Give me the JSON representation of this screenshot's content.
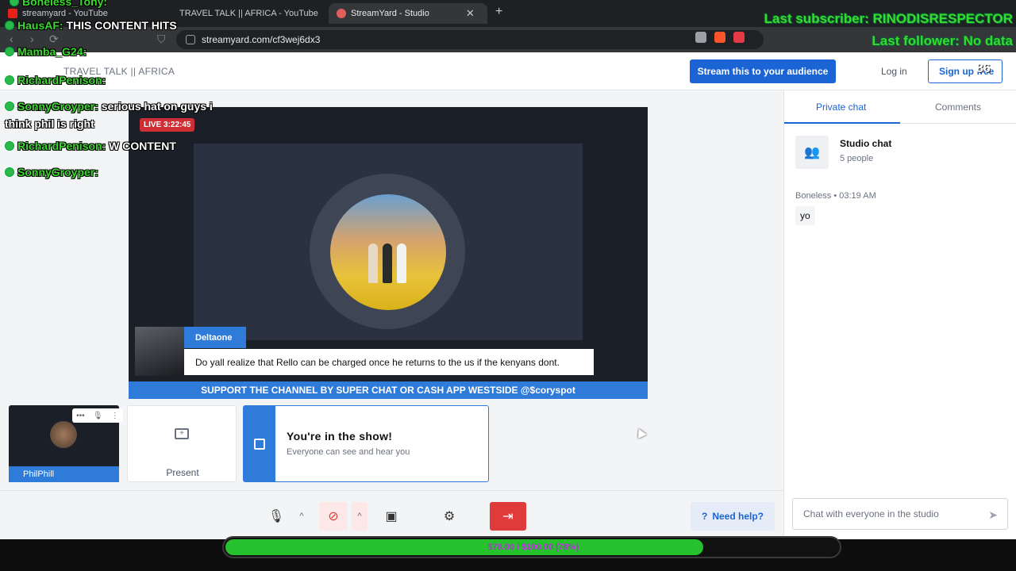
{
  "browser": {
    "tabs": [
      {
        "label": "streamyard - YouTube"
      },
      {
        "label": "TRAVEL TALK || AFRICA - YouTube"
      },
      {
        "label": "StreamYard - Studio"
      }
    ],
    "url": "streamyard.com/cf3wej6dx3"
  },
  "header": {
    "show_title": "TRAVEL TALK || AFRICA",
    "stream_button": "Stream this to your audience",
    "login": "Log in",
    "signup": "Sign up free"
  },
  "stage": {
    "live_badge": "LIVE 3:22:45",
    "comment_author": "Deltaone",
    "comment_text": "Do yall realize that Rello can be charged once he returns to the us if the kenyans dont.",
    "ticker": "SUPPORT THE CHANNEL BY SUPER CHAT OR CASH APP WESTSIDE @$coryspot"
  },
  "tiles": {
    "participant_name": "PhilPhill",
    "present_label": "Present",
    "show_title": "You're in the show!",
    "show_sub": "Everyone can see and hear you"
  },
  "controls": {
    "need_help": "Need help?"
  },
  "chat": {
    "tab_private": "Private chat",
    "tab_comments": "Comments",
    "studio_title": "Studio chat",
    "studio_sub": "5 people",
    "messages": [
      {
        "author": "Boneless",
        "time": "03:19 AM",
        "text": "yo"
      }
    ],
    "input_placeholder": "Chat with everyone in the studio"
  },
  "overlay_chat": [
    {
      "name": "Boneless_Tony:",
      "msg": ""
    },
    {
      "name": "HausAF:",
      "msg": "THIS CONTENT HITS"
    },
    {
      "name": "Mamba_G24:",
      "msg": ""
    },
    {
      "name": "RichardPenison:",
      "msg": ""
    },
    {
      "name": "SonnyGroyper:",
      "msg": "serious hat on guys i"
    },
    {
      "name": "",
      "msg": "think phil is right"
    },
    {
      "name": "RichardPenison:",
      "msg": "W CONTENT"
    },
    {
      "name": "SonnyGroyper:",
      "msg": ""
    }
  ],
  "overlay_sub": {
    "last_subscriber": "Last subscriber: RINODISRESPECTOR",
    "last_follower": "Last follower: No data",
    "count": "86"
  },
  "goal": {
    "text": "$78.00 / $100.00 (78%)",
    "progress": 0.78
  },
  "colors": {
    "accent": "#1a64d6",
    "live": "#d02e35",
    "overlay_green": "#3bd92f"
  }
}
